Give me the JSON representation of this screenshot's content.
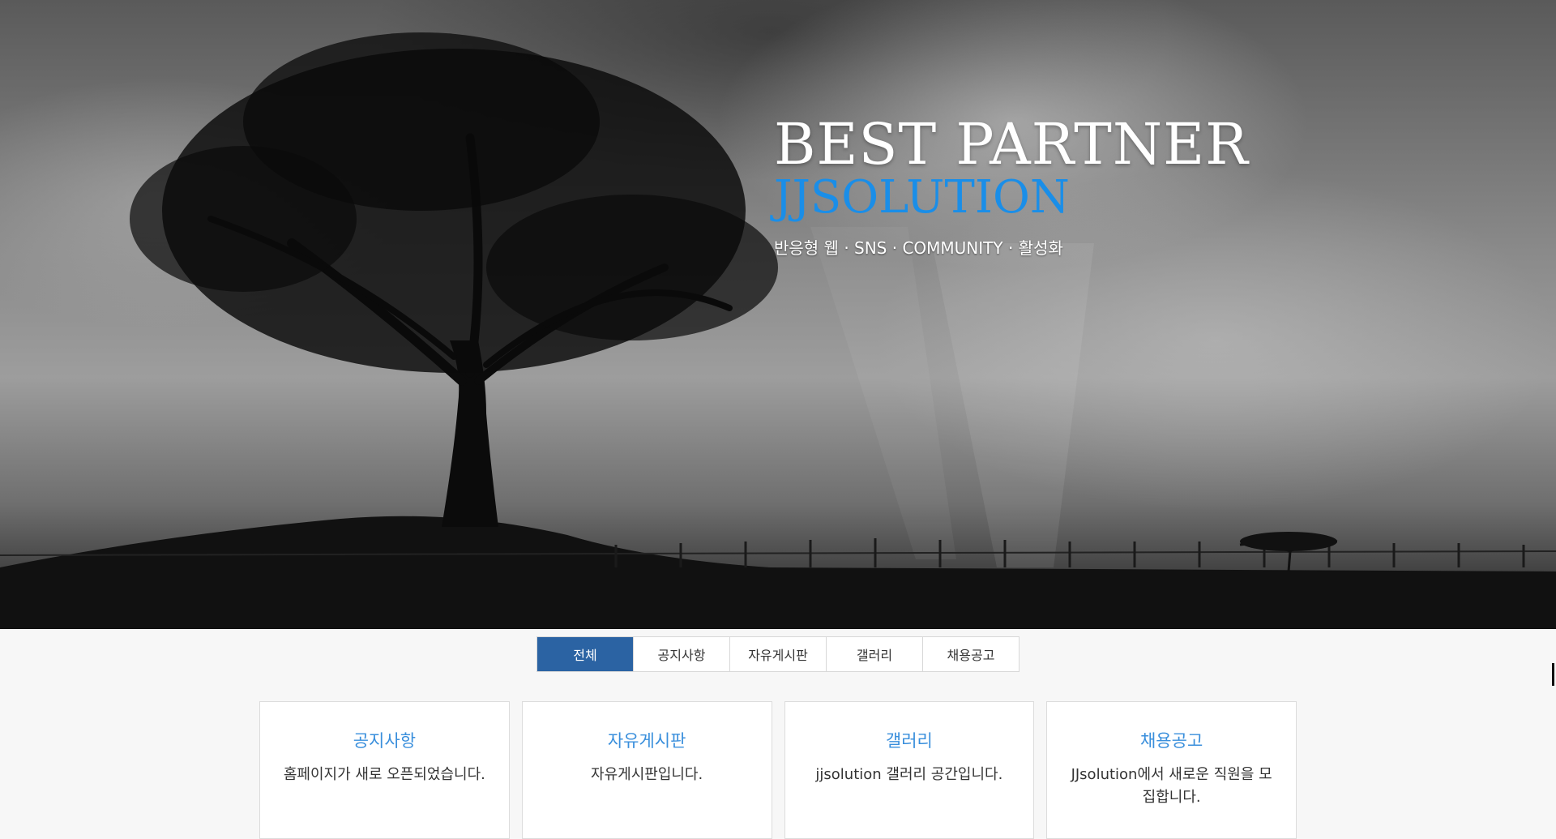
{
  "hero": {
    "title": "BEST PARTNER",
    "brand": "JJSOLUTION",
    "subtitle": "반응형 웹 · SNS · COMMUNITY · 활성화",
    "background_image": "black-and-white tree silhouette under stormy sky",
    "brand_color": "#1a8ee8"
  },
  "tabs": [
    {
      "label": "전체",
      "active": true
    },
    {
      "label": "공지사항",
      "active": false
    },
    {
      "label": "자유게시판",
      "active": false
    },
    {
      "label": "갤러리",
      "active": false
    },
    {
      "label": "채용공고",
      "active": false
    }
  ],
  "cards": [
    {
      "title": "공지사항",
      "text": "홈페이지가 새로 오픈되었습니다."
    },
    {
      "title": "자유게시판",
      "text": "자유게시판입니다."
    },
    {
      "title": "갤러리",
      "text": "jjsolution 갤러리 공간입니다."
    },
    {
      "title": "채용공고",
      "text": "JJsolution에서 새로운 직원을 모집합니다."
    }
  ],
  "colors": {
    "active_tab": "#2b63a3",
    "card_title": "#3a8fdc"
  }
}
